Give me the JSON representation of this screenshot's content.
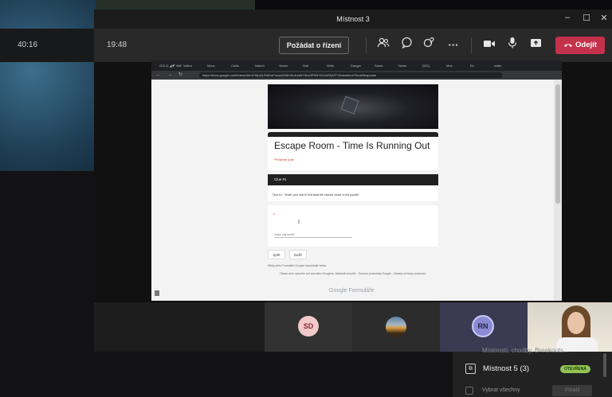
{
  "window": {
    "title": "Místnost 3",
    "minimize": "–",
    "maximize": "☐",
    "close": "✕"
  },
  "timers": {
    "outer": "40:16",
    "inner": "19:48"
  },
  "toolbar": {
    "request_control": "Požádat o řízení",
    "more": "···",
    "leave": "Odejít",
    "icons": [
      "people-icon",
      "chat-icon",
      "reactions-icon",
      "more-icon",
      "camera-icon",
      "mic-icon",
      "share-icon",
      "phone-icon"
    ]
  },
  "browser": {
    "tabs": [
      "GOLD ◢ ◤ Wilf",
      "Velkhr",
      "Monv",
      "Cedic",
      "Naheh",
      "Vecen",
      "Safi",
      "Wide",
      "Danger",
      "Samb",
      "Nowe",
      "(521)",
      "Muh",
      "Es",
      "wider"
    ],
    "url": "https://docs.google.com/forms/d/e/1FAIpQLSf4GoFmcaAXWrcSuA1sBYWuOPHNYiCGeFAVZTYf/viewform?formResponse"
  },
  "form": {
    "title": "Escape Room - Time Is Running Out",
    "required_note": "*Povinné pole",
    "section_title": "Clue #1",
    "section_description": "Clue #1 - Smart, just look to find what the chance closer to the puzzle!",
    "question_star": "*",
    "answer_placeholder": "Vaše odpověď",
    "back_button": "Zpět",
    "next_button": "Další",
    "never_submit_note": "Nikdy přes Formuláře Google neposílejte hesla.",
    "footer_note": "Obsah není vytvořen ani schválen Googlem. Nahlásit zneužití - Smluvní podmínky Google - Zásady ochrany soukromí",
    "brand": "Google Formuláře"
  },
  "participants": [
    {
      "initials": "SD",
      "color": "#f1c9c9"
    },
    {
      "initials": "",
      "kind": "image"
    },
    {
      "initials": "RN",
      "color": "#8a8bd4"
    },
    {
      "initials": "",
      "kind": "camera"
    }
  ],
  "breakout_panel": {
    "partial_item": "Místnosti, chodby, Breakouts...",
    "room_name": "Místnost 5 (3)",
    "room_status": "OTEVŘENÁ",
    "select_all": "Vybrat všechny",
    "assign": "Přiřadit"
  }
}
